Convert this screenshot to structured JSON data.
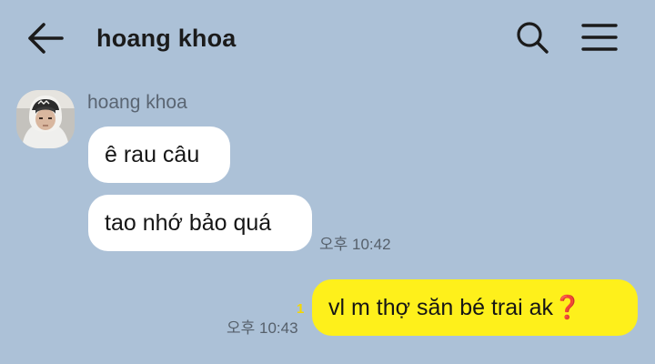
{
  "header": {
    "back_icon": "arrow-left-icon",
    "title": "hoang khoa",
    "search_icon": "search-icon",
    "menu_icon": "hamburger-menu-icon"
  },
  "conversation": {
    "sender_name": "hoang khoa",
    "avatar_icon": "profile-photo",
    "messages": [
      {
        "direction": "incoming",
        "text": "ê rau câu"
      },
      {
        "direction": "incoming",
        "text": "tao nhớ bảo quá",
        "time": "오후 10:42"
      },
      {
        "direction": "outgoing",
        "text": "vl m thợ săn bé trai ak",
        "emoji": "❓",
        "time": "오후 10:43",
        "unread_count": "1"
      }
    ]
  },
  "colors": {
    "background": "#acc1d7",
    "incoming_bubble": "#ffffff",
    "outgoing_bubble": "#fef01b",
    "unread": "#f5d700"
  }
}
